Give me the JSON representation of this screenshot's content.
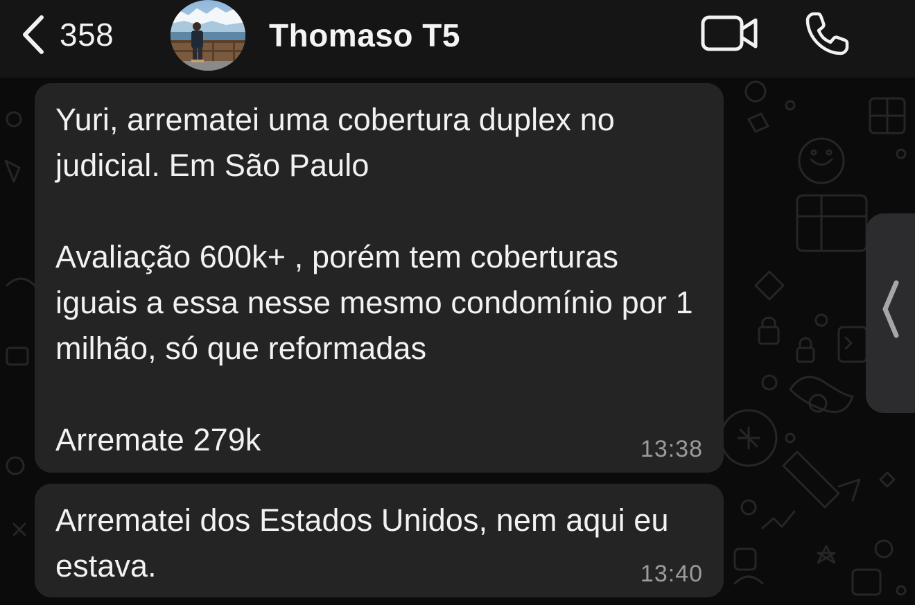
{
  "header": {
    "back_icon": "chevron-left-icon",
    "unread_count": "358",
    "contact_name": "Thomaso T5",
    "avatar_icon": "contact-avatar",
    "video_icon": "video-camera-icon",
    "phone_icon": "phone-icon"
  },
  "messages": [
    {
      "text": "Yuri, arrematei uma cobertura duplex no judicial. Em São Paulo\n\nAvaliação 600k+ , porém tem coberturas iguais a essa nesse mesmo condomínio por 1 milhão, só que reformadas\n\nArremate 279k",
      "time": "13:38"
    },
    {
      "text": "Arrematei dos Estados Unidos, nem aqui eu estava.",
      "time": "13:40"
    }
  ],
  "side_panel": {
    "icon": "chevron-left-icon"
  },
  "colors": {
    "header_bg": "#151515",
    "chat_bg": "#0b0b0b",
    "bubble_bg": "#242424",
    "text": "#f2f2f2",
    "timestamp": "#9b9b9b"
  }
}
